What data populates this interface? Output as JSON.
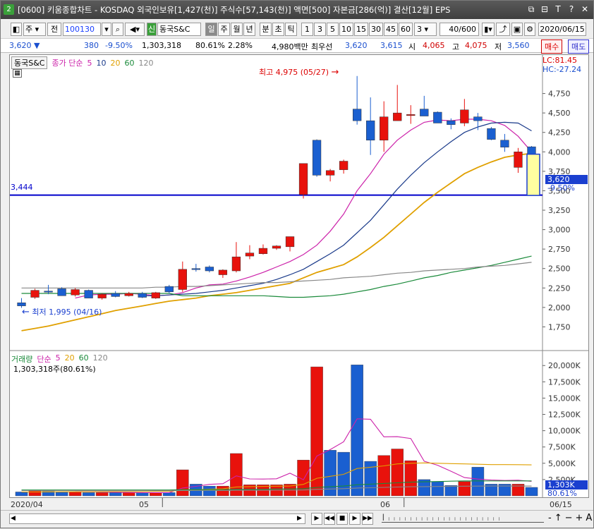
{
  "window": {
    "number": "2",
    "title": "[0600] 키움종합차트 - KOSDAQ 외국인보유[1,427(천)] 주식수[57,143(천)] 액면[500] 자본금[286(억)] 결산[12월] EPS",
    "buttons": [
      "⧉",
      "⊟",
      "T",
      "?",
      "✕"
    ]
  },
  "toolbar": {
    "type_label": "주",
    "type2_label": "전",
    "code_value": "100130",
    "stock_name": "동국S&C",
    "new_badge": "신",
    "periods": [
      "일",
      "주",
      "월",
      "년",
      "분",
      "초",
      "틱"
    ],
    "selected_period": "일",
    "intervals": [
      "1",
      "3",
      "5",
      "10",
      "15",
      "30",
      "45",
      "60"
    ],
    "interval_value": "3",
    "count_value": "40/600",
    "date_value": "2020/06/15"
  },
  "quote": {
    "price": "3,620",
    "arrow": "▼",
    "change": "380",
    "change_pct": "-9.50%",
    "volume": "1,303,318",
    "vol_ratio": "80.61%",
    "turnover": "2.28%",
    "amount": "4,980백만",
    "best_label": "최우선",
    "ask": "3,620",
    "bid": "3,615",
    "open_label": "시",
    "open": "4,065",
    "high_label": "고",
    "high": "4,075",
    "low_label": "저",
    "low": "3,560",
    "buy_label": "매수",
    "sell_label": "매도"
  },
  "price_chart": {
    "name_tag": "동국S&C",
    "ma_label": "종가 단순",
    "ma_periods": [
      "5",
      "10",
      "20",
      "60",
      "120"
    ],
    "ma_colors": [
      "#cc22aa",
      "#1a3a8a",
      "#e0a000",
      "#1a8a3a",
      "#888888"
    ],
    "lc": "LC:81.45",
    "hc": "HC:-27.24",
    "hline_value": "3,444",
    "high_annot": "최고 4,975 (05/27)",
    "low_annot": "최저 1,995 (04/16)",
    "last_price_tag": "3,620",
    "last_pct_tag": "-9.50%"
  },
  "volume_chart": {
    "label": "거래량",
    "ma_label": "단순",
    "ma_periods": [
      "5",
      "20",
      "60",
      "120"
    ],
    "ma_colors": [
      "#cc22aa",
      "#e0a000",
      "#1a8a3a",
      "#888888"
    ],
    "last_value": "1,303,318주(80.61%)",
    "last_tag": "1,303K",
    "last_pct_tag": "80.61%"
  },
  "xaxis": {
    "labels": [
      "2020/04",
      "05",
      "06",
      "06/15"
    ]
  },
  "chart_data": [
    {
      "type": "candlestick",
      "title": "",
      "ylim": [
        1500,
        5000
      ],
      "yticks": [
        1750,
        2000,
        2250,
        2500,
        2750,
        3000,
        3250,
        3500,
        3750,
        4000,
        4250,
        4500,
        4750
      ],
      "ytick_labels": [
        "1,750",
        "2,000",
        "2,250",
        "2,500",
        "2,750",
        "3,000",
        "3,250",
        "3,500",
        "3,750",
        "4,000",
        "4,250",
        "4,500",
        "4,750"
      ],
      "candles": [
        {
          "o": 2060,
          "h": 2120,
          "l": 1995,
          "c": 2020
        },
        {
          "o": 2130,
          "h": 2240,
          "l": 2110,
          "c": 2220
        },
        {
          "o": 2210,
          "h": 2290,
          "l": 2170,
          "c": 2200
        },
        {
          "o": 2240,
          "h": 2260,
          "l": 2150,
          "c": 2150
        },
        {
          "o": 2160,
          "h": 2250,
          "l": 2140,
          "c": 2230
        },
        {
          "o": 2220,
          "h": 2230,
          "l": 2120,
          "c": 2120
        },
        {
          "o": 2120,
          "h": 2180,
          "l": 2100,
          "c": 2170
        },
        {
          "o": 2180,
          "h": 2210,
          "l": 2130,
          "c": 2140
        },
        {
          "o": 2150,
          "h": 2200,
          "l": 2140,
          "c": 2180
        },
        {
          "o": 2180,
          "h": 2200,
          "l": 2120,
          "c": 2130
        },
        {
          "o": 2120,
          "h": 2200,
          "l": 2110,
          "c": 2190
        },
        {
          "o": 2270,
          "h": 2290,
          "l": 2180,
          "c": 2200
        },
        {
          "o": 2230,
          "h": 2590,
          "l": 2200,
          "c": 2490
        },
        {
          "o": 2500,
          "h": 2560,
          "l": 2460,
          "c": 2490
        },
        {
          "o": 2520,
          "h": 2540,
          "l": 2450,
          "c": 2470
        },
        {
          "o": 2420,
          "h": 2490,
          "l": 2380,
          "c": 2480
        },
        {
          "o": 2470,
          "h": 2840,
          "l": 2450,
          "c": 2650
        },
        {
          "o": 2660,
          "h": 2800,
          "l": 2620,
          "c": 2700
        },
        {
          "o": 2690,
          "h": 2810,
          "l": 2680,
          "c": 2760
        },
        {
          "o": 2760,
          "h": 2800,
          "l": 2740,
          "c": 2790
        },
        {
          "o": 2780,
          "h": 2900,
          "l": 2720,
          "c": 2910
        },
        {
          "o": 3450,
          "h": 3850,
          "l": 3400,
          "c": 3850
        },
        {
          "o": 4150,
          "h": 4160,
          "l": 3680,
          "c": 3700
        },
        {
          "o": 3700,
          "h": 3780,
          "l": 3620,
          "c": 3760
        },
        {
          "o": 3770,
          "h": 3900,
          "l": 3720,
          "c": 3880
        },
        {
          "o": 4550,
          "h": 4975,
          "l": 4350,
          "c": 4400
        },
        {
          "o": 4400,
          "h": 4700,
          "l": 3960,
          "c": 4150
        },
        {
          "o": 4150,
          "h": 4650,
          "l": 4000,
          "c": 4450
        },
        {
          "o": 4400,
          "h": 4860,
          "l": 4400,
          "c": 4500
        },
        {
          "o": 4470,
          "h": 4600,
          "l": 4360,
          "c": 4480
        },
        {
          "o": 4550,
          "h": 4720,
          "l": 4480,
          "c": 4460
        },
        {
          "o": 4510,
          "h": 4520,
          "l": 4380,
          "c": 4370
        },
        {
          "o": 4400,
          "h": 4430,
          "l": 4290,
          "c": 4350
        },
        {
          "o": 4370,
          "h": 4680,
          "l": 4330,
          "c": 4540
        },
        {
          "o": 4450,
          "h": 4500,
          "l": 4280,
          "c": 4400
        },
        {
          "o": 4300,
          "h": 4320,
          "l": 4150,
          "c": 4160
        },
        {
          "o": 4150,
          "h": 4230,
          "l": 4000,
          "c": 4060
        },
        {
          "o": 3800,
          "h": 4050,
          "l": 3730,
          "c": 4000
        },
        {
          "o": 4065,
          "h": 4075,
          "l": 3560,
          "c": 3620
        }
      ],
      "ma": [
        {
          "name": "5",
          "values": [
            null,
            null,
            null,
            null,
            2120,
            2160,
            2170,
            2170,
            2180,
            2170,
            2150,
            2160,
            2190,
            2250,
            2290,
            2300,
            2340,
            2390,
            2450,
            2520,
            2590,
            2680,
            2800,
            2980,
            3200,
            3500,
            3720,
            3970,
            4150,
            4280,
            4380,
            4410,
            4400,
            4420,
            4420,
            4400,
            4340,
            4200,
            4000
          ]
        },
        {
          "name": "10",
          "values": [
            null,
            null,
            null,
            null,
            null,
            null,
            null,
            null,
            null,
            2150,
            2150,
            2160,
            2170,
            2180,
            2200,
            2220,
            2250,
            2280,
            2310,
            2360,
            2420,
            2490,
            2590,
            2690,
            2800,
            2960,
            3120,
            3320,
            3520,
            3700,
            3860,
            4000,
            4130,
            4250,
            4320,
            4370,
            4380,
            4370,
            4270
          ]
        },
        {
          "name": "20",
          "values": [
            1700,
            1730,
            1760,
            1800,
            1840,
            1880,
            1920,
            1960,
            1990,
            2020,
            2050,
            2080,
            2100,
            2120,
            2150,
            2170,
            2190,
            2220,
            2250,
            2280,
            2310,
            2380,
            2450,
            2500,
            2550,
            2650,
            2770,
            2900,
            3050,
            3200,
            3350,
            3480,
            3600,
            3720,
            3800,
            3870,
            3930,
            3960,
            3980
          ]
        },
        {
          "name": "60",
          "values": [
            2180,
            2180,
            2180,
            2180,
            2180,
            2180,
            2180,
            2180,
            2180,
            2180,
            2180,
            2180,
            2150,
            2150,
            2150,
            2150,
            2150,
            2150,
            2150,
            2140,
            2130,
            2130,
            2140,
            2150,
            2170,
            2200,
            2230,
            2270,
            2300,
            2340,
            2380,
            2410,
            2450,
            2480,
            2510,
            2540,
            2580,
            2620,
            2660
          ]
        },
        {
          "name": "120",
          "values": [
            2250,
            2250,
            2250,
            2250,
            2250,
            2250,
            2250,
            2250,
            2250,
            2250,
            2260,
            2260,
            2270,
            2270,
            2280,
            2290,
            2300,
            2310,
            2320,
            2320,
            2330,
            2340,
            2350,
            2360,
            2380,
            2390,
            2400,
            2420,
            2440,
            2450,
            2470,
            2480,
            2490,
            2500,
            2520,
            2530,
            2540,
            2560,
            2580
          ]
        }
      ]
    },
    {
      "type": "bar",
      "title": "",
      "ylim": [
        0,
        21000
      ],
      "yticks": [
        2500,
        5000,
        7500,
        10000,
        12500,
        15000,
        17500,
        20000
      ],
      "ytick_labels": [
        "2,500K",
        "5,000K",
        "7,500K",
        "10,000K",
        "12,500K",
        "15,000K",
        "17,500K",
        "20,000K"
      ],
      "values": [
        600,
        800,
        700,
        600,
        600,
        500,
        500,
        500,
        500,
        500,
        500,
        500,
        4000,
        1800,
        1500,
        1500,
        6500,
        1700,
        1700,
        1700,
        1800,
        5500,
        19800,
        7000,
        6700,
        20100,
        5300,
        6200,
        7200,
        5400,
        2500,
        2200,
        1600,
        2200,
        4400,
        1800,
        1800,
        1800,
        1303
      ],
      "up": [
        false,
        true,
        false,
        false,
        true,
        false,
        true,
        false,
        true,
        false,
        true,
        false,
        true,
        false,
        false,
        true,
        true,
        true,
        true,
        true,
        true,
        true,
        true,
        false,
        false,
        false,
        false,
        true,
        true,
        true,
        false,
        false,
        false,
        true,
        false,
        false,
        false,
        true,
        false
      ],
      "ma": [
        {
          "name": "5",
          "values": [
            null,
            null,
            null,
            null,
            640,
            640,
            580,
            540,
            520,
            500,
            500,
            500,
            1200,
            1460,
            1760,
            1860,
            3060,
            2600,
            2580,
            2620,
            3480,
            2480,
            6100,
            7100,
            8300,
            11820,
            11760,
            9060,
            9080,
            8800,
            5320,
            4700,
            3780,
            2800,
            2580,
            2440,
            2360,
            2400,
            2220
          ]
        },
        {
          "name": "20",
          "values": [
            600,
            600,
            610,
            620,
            630,
            630,
            640,
            650,
            650,
            650,
            700,
            700,
            870,
            950,
            1020,
            1080,
            1360,
            1420,
            1450,
            1480,
            1500,
            1760,
            2700,
            3000,
            3300,
            4200,
            4400,
            4600,
            4900,
            5000,
            5050,
            5000,
            4950,
            4900,
            4850,
            4800,
            4800,
            4780,
            4750
          ]
        },
        {
          "name": "60",
          "values": [
            900,
            900,
            900,
            900,
            900,
            900,
            900,
            900,
            900,
            900,
            900,
            900,
            950,
            950,
            950,
            950,
            1000,
            1000,
            1000,
            1050,
            1050,
            1100,
            1300,
            1400,
            1500,
            1700,
            1800,
            1900,
            2000,
            2100,
            2150,
            2200,
            2250,
            2300,
            2300,
            2300,
            2300,
            2300,
            2300
          ]
        },
        {
          "name": "120",
          "values": [
            800,
            800,
            800,
            800,
            800,
            800,
            800,
            800,
            800,
            800,
            800,
            800,
            820,
            820,
            820,
            820,
            850,
            850,
            850,
            870,
            870,
            900,
            1000,
            1050,
            1100,
            1200,
            1250,
            1300,
            1350,
            1400,
            1420,
            1440,
            1460,
            1480,
            1490,
            1500,
            1500,
            1500,
            1500
          ]
        }
      ]
    }
  ]
}
